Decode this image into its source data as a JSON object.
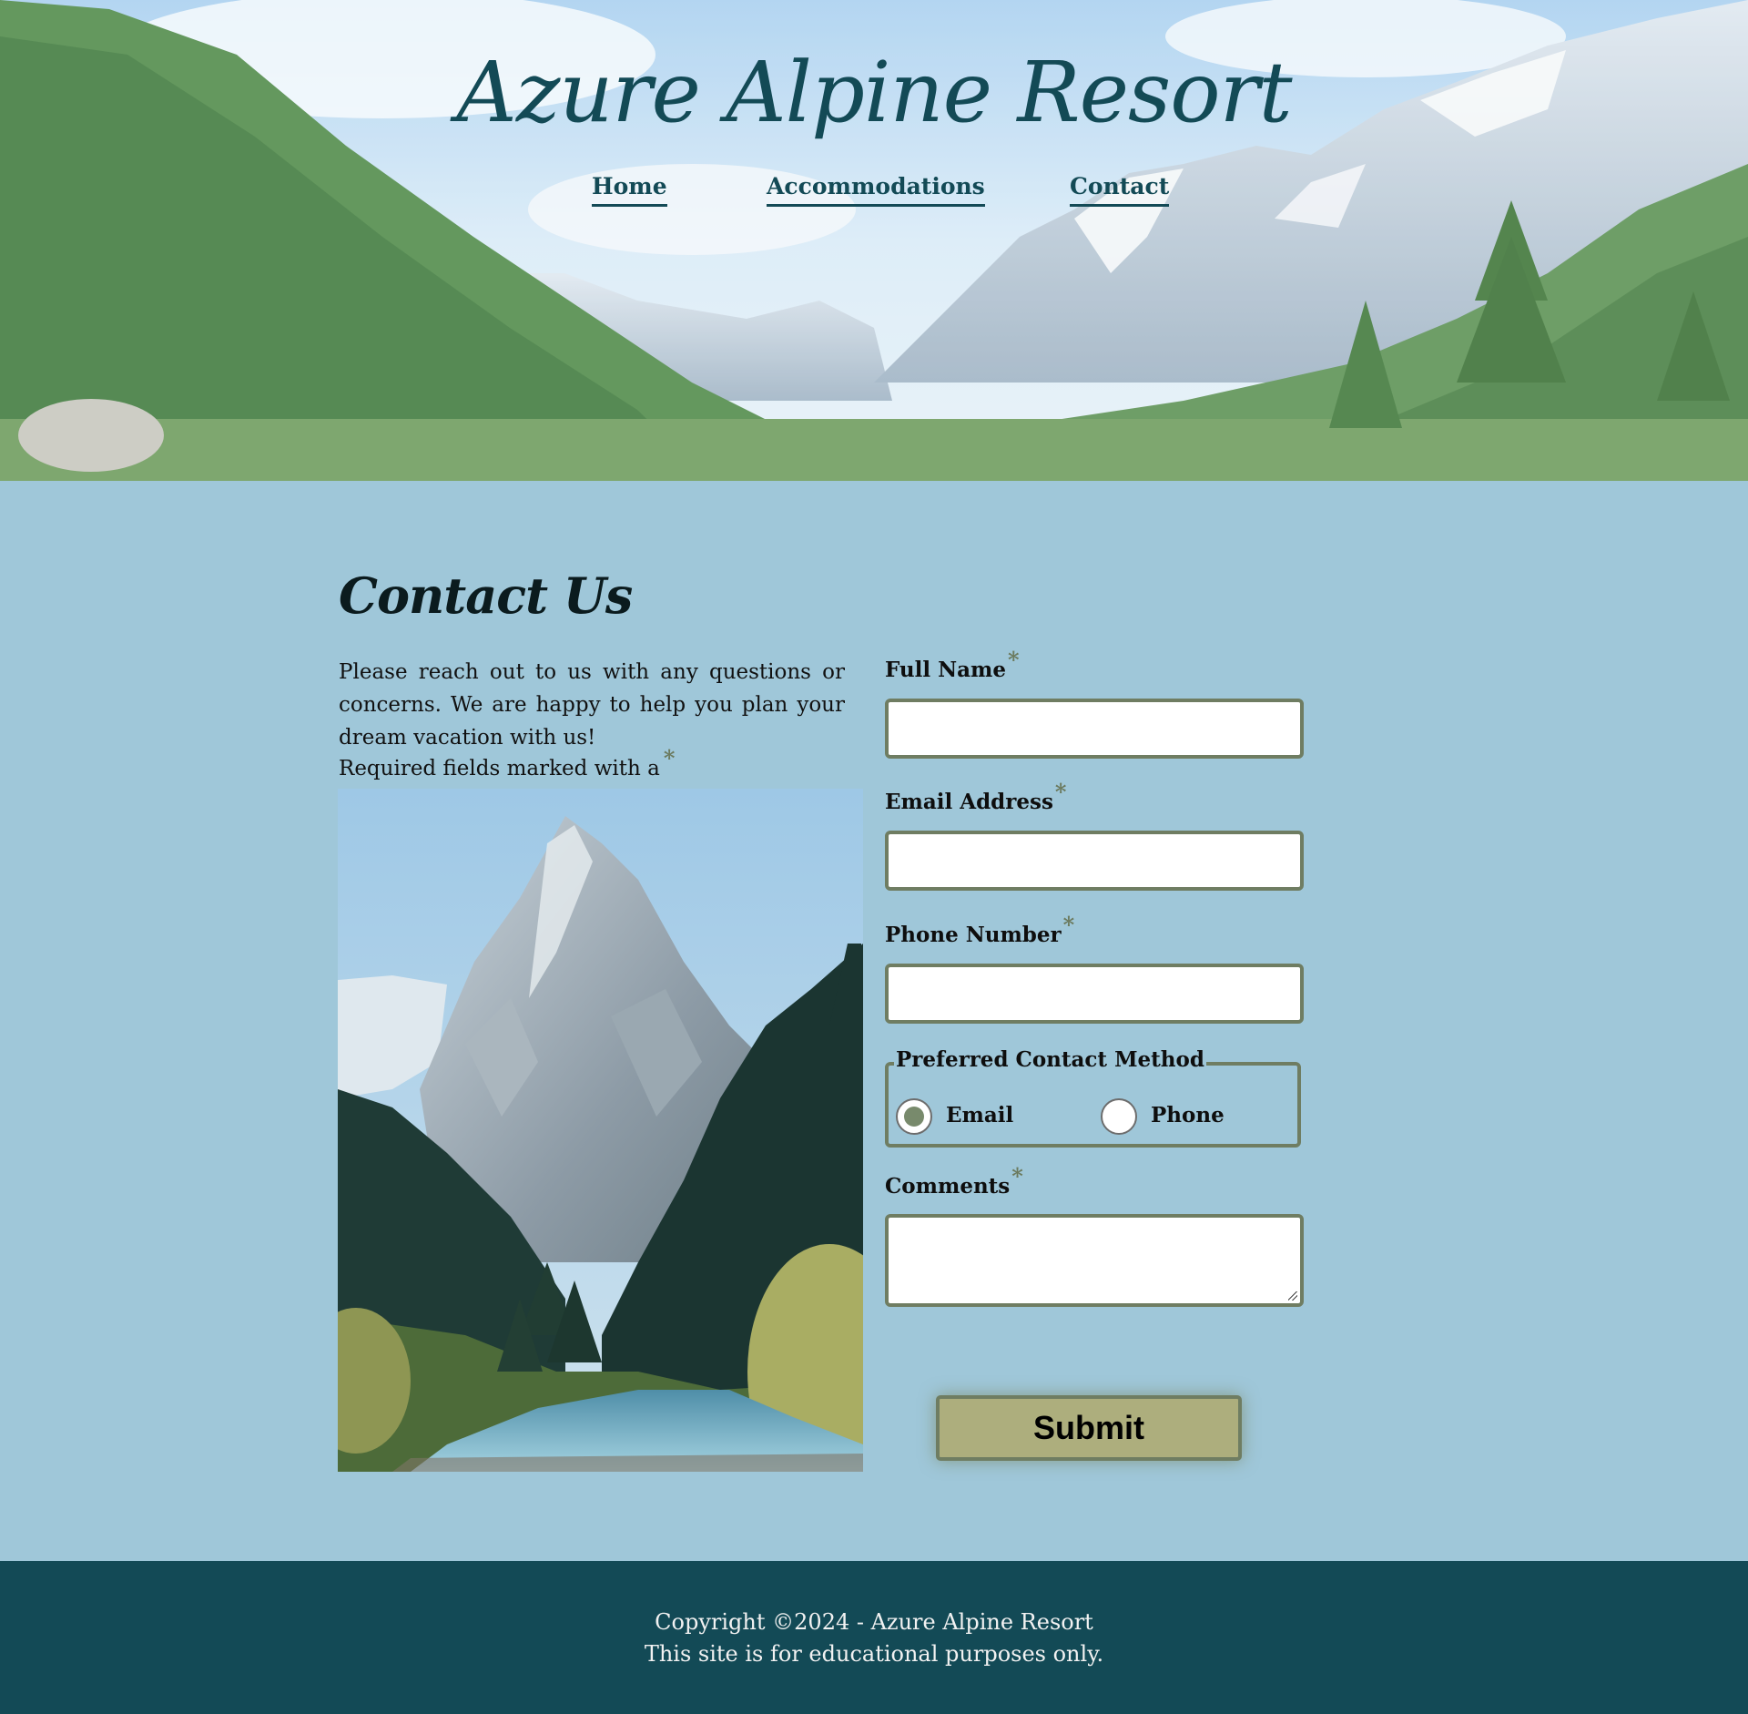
{
  "header": {
    "site_title": "Azure Alpine Resort",
    "nav": [
      {
        "label": "Home"
      },
      {
        "label": "Accommodations"
      },
      {
        "label": "Contact"
      }
    ]
  },
  "main": {
    "heading": "Contact Us",
    "intro": "Please reach out to us with any questions or concerns. We are happy to help you plan your dream vacation with us!",
    "required_note": "Required fields marked with a",
    "required_marker": "*",
    "form": {
      "full_name_label": "Full Name",
      "email_label": "Email Address",
      "phone_label": "Phone Number",
      "contact_method_legend": "Preferred Contact Method",
      "contact_method_options": [
        "Email",
        "Phone"
      ],
      "contact_method_selected": "Email",
      "comments_label": "Comments",
      "submit_label": "Submit"
    }
  },
  "footer": {
    "copyright": "Copyright ©2024 - Azure Alpine Resort",
    "disclaimer": "This site is for educational purposes only."
  },
  "colors": {
    "page_background": "#9fc7d9",
    "brand_dark_teal": "#134a56",
    "field_border": "#6f7d62",
    "submit_background": "#adae7d"
  }
}
